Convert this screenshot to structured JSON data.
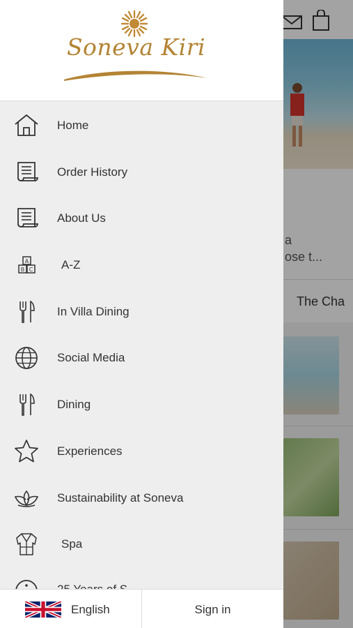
{
  "brand": {
    "logo_text": "Soneva Kiri",
    "accent": "#b38434"
  },
  "menu": {
    "items": [
      {
        "label": "Home",
        "icon": "home-icon"
      },
      {
        "label": "Order History",
        "icon": "receipt-icon"
      },
      {
        "label": "About Us",
        "icon": "document-icon"
      },
      {
        "label": "A-Z",
        "icon": "abc-blocks-icon"
      },
      {
        "label": "In Villa Dining",
        "icon": "fork-knife-icon"
      },
      {
        "label": "Social Media",
        "icon": "globe-icon"
      },
      {
        "label": "Dining",
        "icon": "fork-knife-icon"
      },
      {
        "label": "Experiences",
        "icon": "star-icon"
      },
      {
        "label": "Sustainability at Soneva",
        "icon": "lotus-icon"
      },
      {
        "label": "Spa",
        "icon": "robe-icon"
      },
      {
        "label": "25 Years of S...",
        "icon": "info-icon"
      }
    ]
  },
  "footer": {
    "language_label": "English",
    "signin_label": "Sign in"
  },
  "background": {
    "text_line_a": "a",
    "text_line_b": "ose t...",
    "tab_label": "The Cha"
  }
}
